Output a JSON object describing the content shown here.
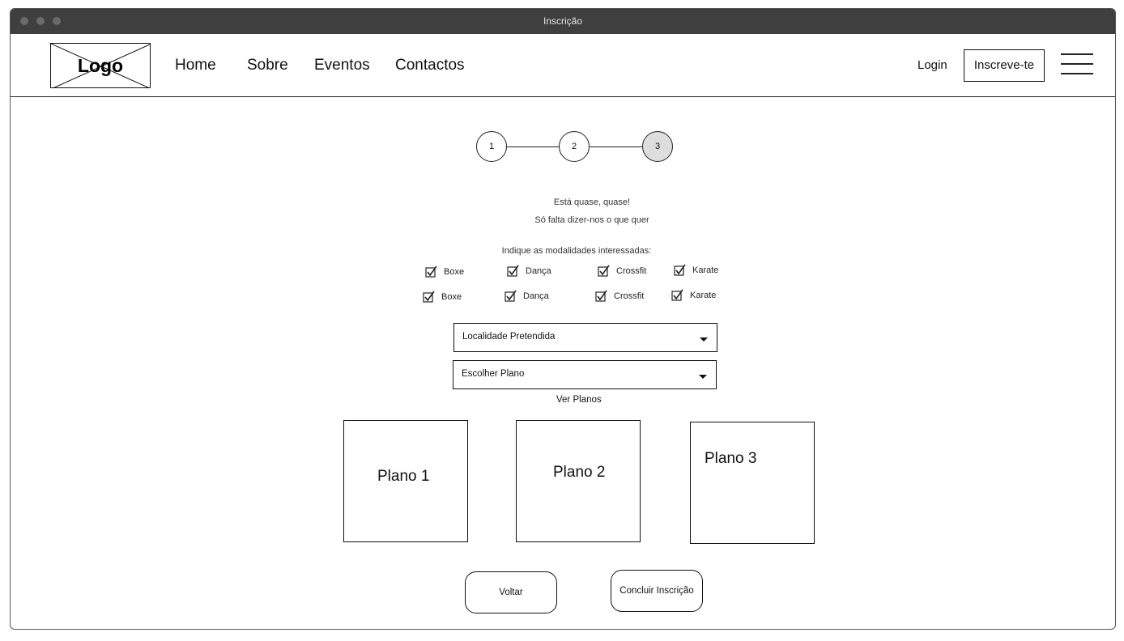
{
  "window": {
    "title": "Inscrição"
  },
  "nav": {
    "logo": "Logo",
    "links": [
      "Home",
      "Sobre",
      "Eventos",
      "Contactos"
    ],
    "login": "Login",
    "signup": "Inscreve-te"
  },
  "stepper": {
    "steps": [
      "1",
      "2",
      "3"
    ],
    "active_step": 3
  },
  "intro": {
    "line1": "Está quase, quase!",
    "line2": "Só falta dizer-nos o que quer"
  },
  "modalities": {
    "prompt": "Indique as modalidades interessadas:",
    "row1": [
      "Boxe",
      "Dança",
      "Crossfit",
      "Karate"
    ],
    "row2": [
      "Boxe",
      "Dança",
      "Crossfit",
      "Karate"
    ],
    "checked": true
  },
  "location_select": {
    "value": "Localidade Pretendida"
  },
  "plan_select": {
    "value": "Escolher Plano"
  },
  "view_plans": "Ver Planos",
  "plans": [
    "Plano 1",
    "Plano 2",
    "Plano 3"
  ],
  "buttons": {
    "back": "Voltar",
    "finish": "Concluir Inscrição"
  }
}
